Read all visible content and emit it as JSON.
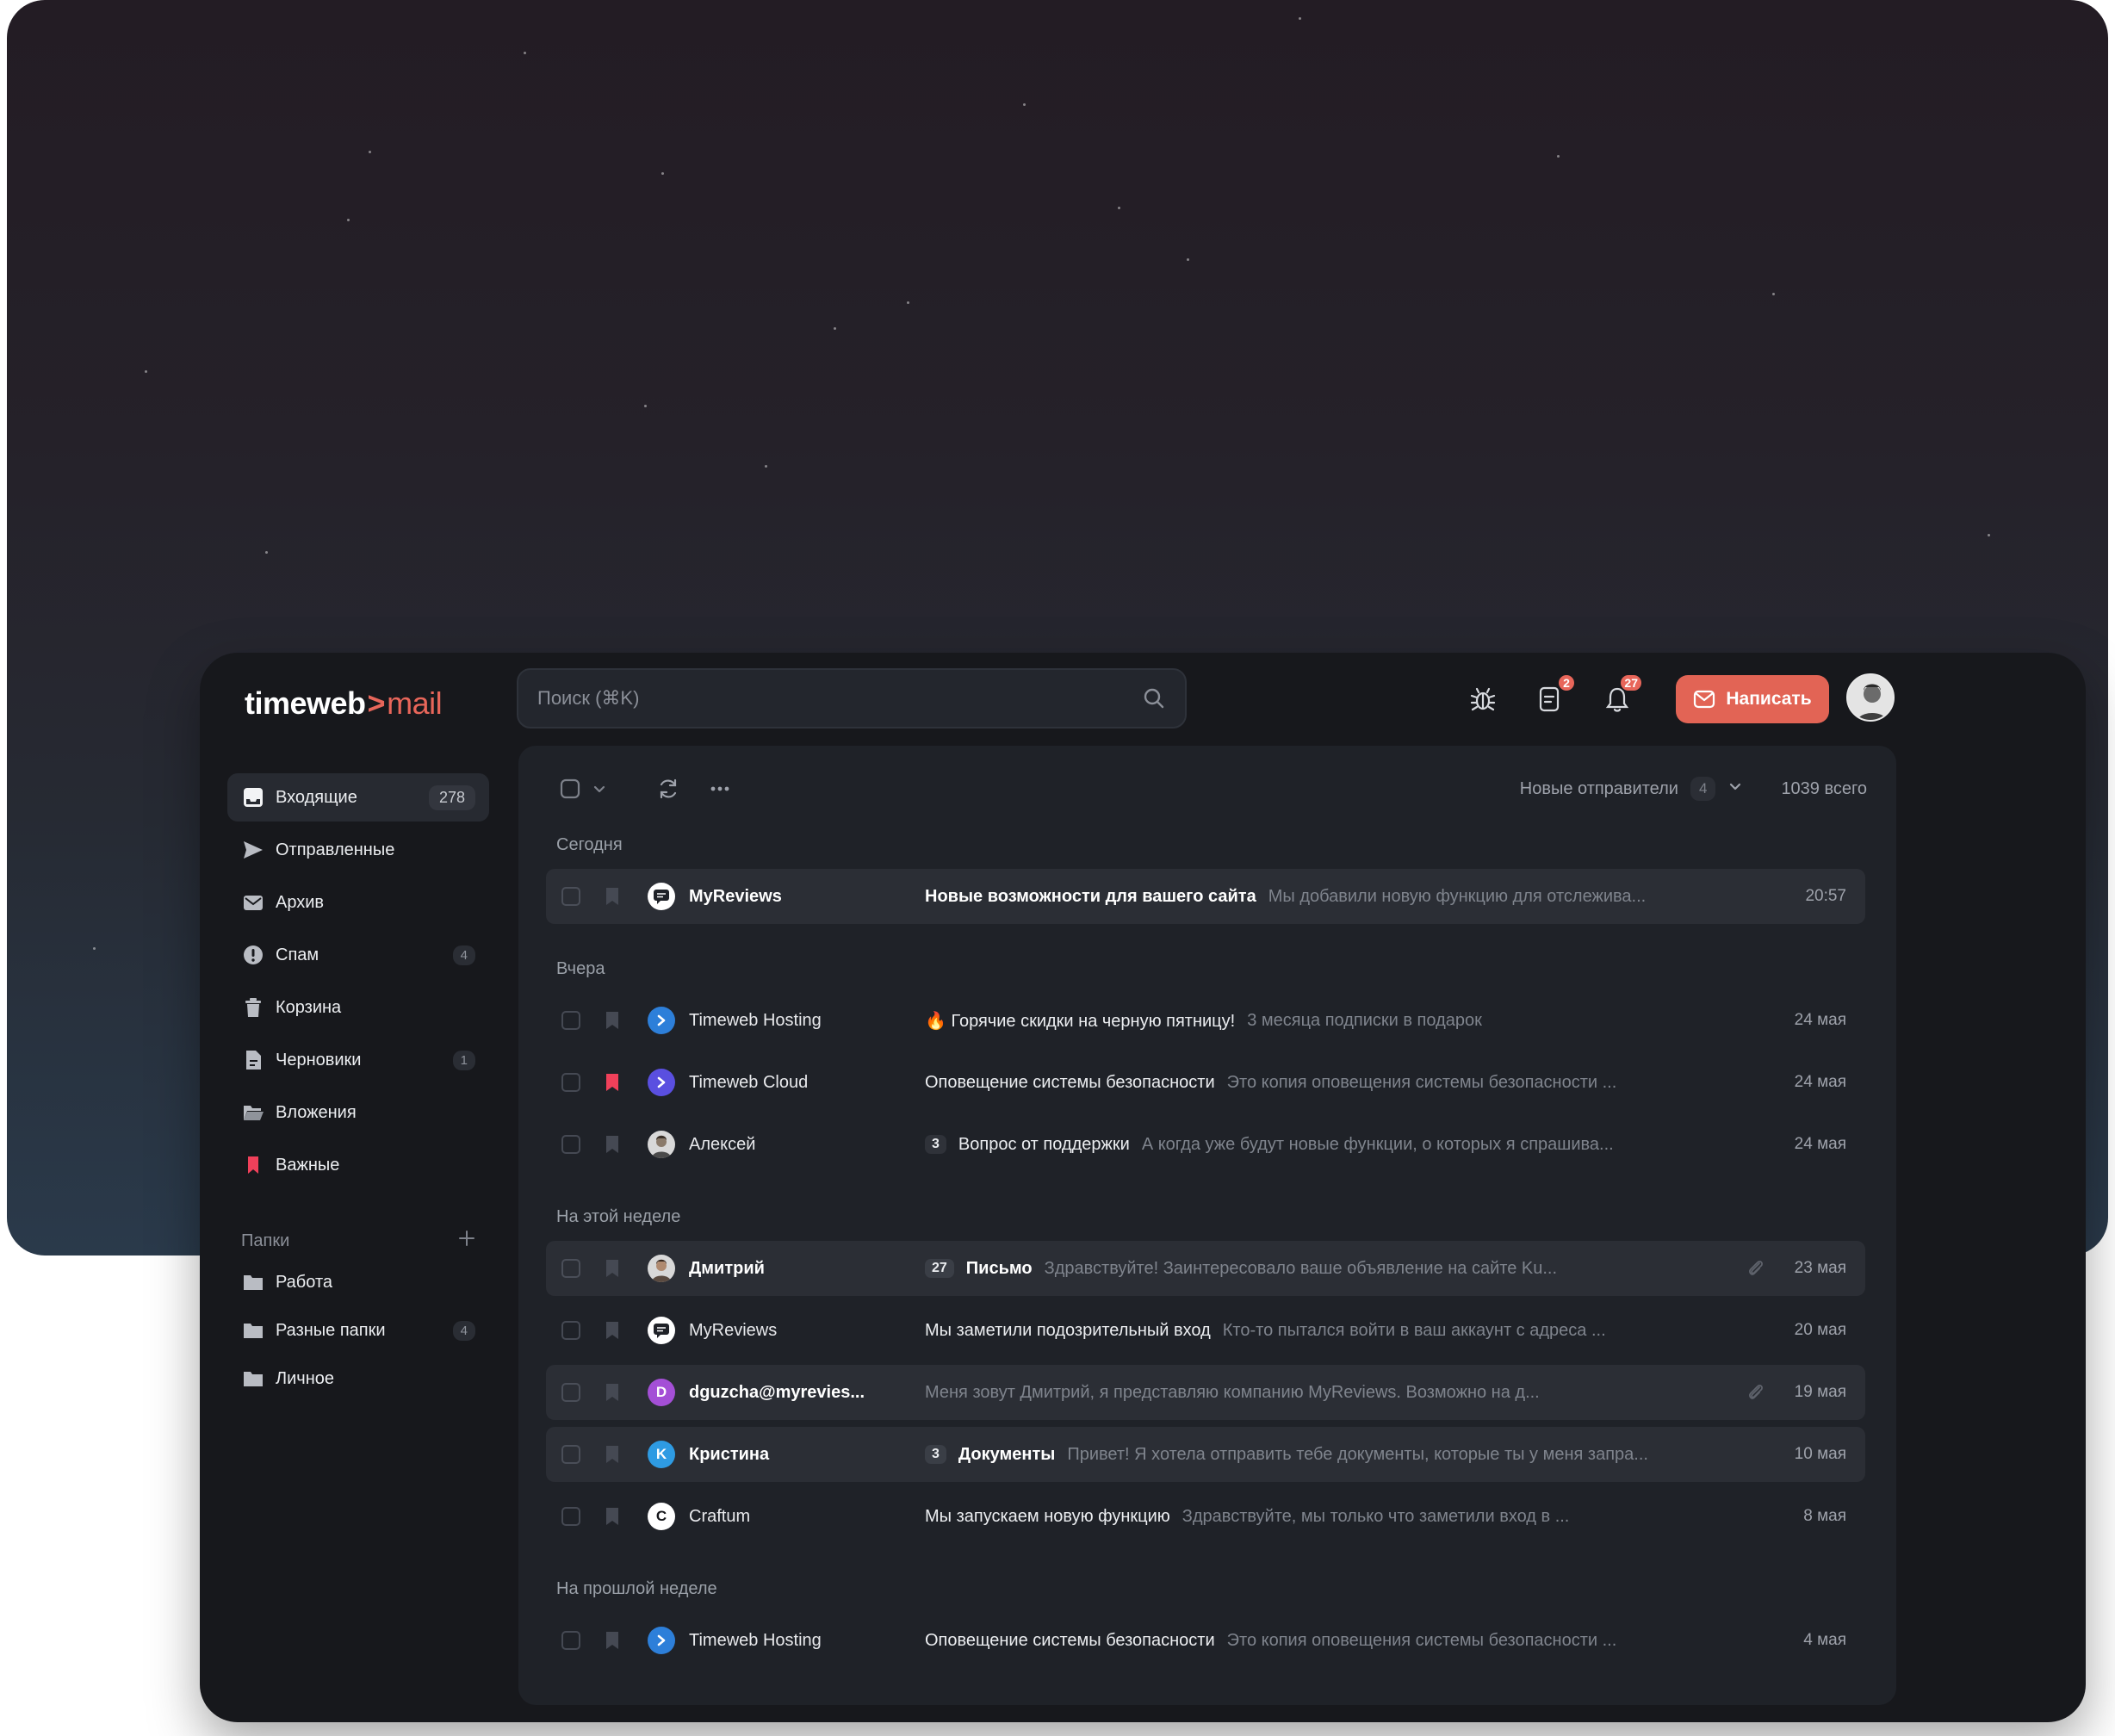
{
  "header": {
    "logo_brand": "timeweb",
    "logo_arrow": ">",
    "logo_product": "mail",
    "search_placeholder": "Поиск (⌘K)",
    "notif_badge_1": "2",
    "notif_badge_2": "27",
    "compose_label": "Написать"
  },
  "sidebar": {
    "items": [
      {
        "label": "Входящие",
        "count": "278"
      },
      {
        "label": "Отправленные",
        "count": ""
      },
      {
        "label": "Архив",
        "count": ""
      },
      {
        "label": "Спам",
        "count": "4"
      },
      {
        "label": "Корзина",
        "count": ""
      },
      {
        "label": "Черновики",
        "count": "1"
      },
      {
        "label": "Вложения",
        "count": ""
      },
      {
        "label": "Важные",
        "count": ""
      }
    ],
    "folders_title": "Папки",
    "folders": [
      {
        "label": "Работа",
        "count": ""
      },
      {
        "label": "Разные папки",
        "count": "4"
      },
      {
        "label": "Личное",
        "count": ""
      }
    ]
  },
  "toolbar": {
    "new_senders_label": "Новые отправители",
    "new_senders_count": "4",
    "total_label": "1039 всего"
  },
  "groups": [
    "Сегодня",
    "Вчера",
    "На этой неделе",
    "На прошлой неделе"
  ],
  "emails": [
    {
      "sender": "MyReviews",
      "count": "",
      "subject": "Новые возможности для вашего сайта",
      "preview": "Мы добавили новую функцию для отслежива...",
      "date": "20:57",
      "avatar": "",
      "unread": true,
      "important": false,
      "attachment": false
    },
    {
      "sender": "Timeweb Hosting",
      "count": "",
      "subject": "🔥 Горячие скидки на черную пятницу!",
      "preview": "3 месяца подписки в подарок",
      "date": "24 мая",
      "avatar": "",
      "unread": false,
      "important": false,
      "attachment": false
    },
    {
      "sender": "Timeweb Cloud",
      "count": "",
      "subject": "Оповещение системы безопасности",
      "preview": "Это копия оповещения системы безопасности ...",
      "date": "24 мая",
      "avatar": "",
      "unread": false,
      "important": true,
      "attachment": false
    },
    {
      "sender": "Алексей",
      "count": "3",
      "subject": "Вопрос от поддержки",
      "preview": "А когда уже будут новые функции, о которых я спрашива...",
      "date": "24 мая",
      "avatar": "",
      "unread": false,
      "important": false,
      "attachment": false
    },
    {
      "sender": "Дмитрий",
      "count": "27",
      "subject": "Письмо",
      "preview": "Здравствуйте! Заинтересовало ваше объявление на сайте Ku...",
      "date": "23 мая",
      "avatar": "",
      "unread": true,
      "important": false,
      "attachment": true
    },
    {
      "sender": "MyReviews",
      "count": "",
      "subject": "Мы заметили подозрительный вход",
      "preview": "Кто-то пытался войти в ваш аккаунт с адреса ...",
      "date": "20 мая",
      "avatar": "",
      "unread": false,
      "important": false,
      "attachment": false
    },
    {
      "sender": "dguzcha@myrevies...",
      "count": "",
      "subject": "",
      "preview": "Меня зовут Дмитрий, я представляю компанию MyReviews. Возможно на д...",
      "date": "19 мая",
      "avatar": "D",
      "unread": true,
      "important": false,
      "attachment": true
    },
    {
      "sender": "Кристина",
      "count": "3",
      "subject": "Документы",
      "preview": "Привет! Я хотела отправить тебе документы, которые ты у меня запра...",
      "date": "10 мая",
      "avatar": "K",
      "unread": true,
      "important": false,
      "attachment": false
    },
    {
      "sender": "Craftum",
      "count": "",
      "subject": "Мы запускаем новую функцию",
      "preview": "Здравствуйте, мы только что заметили вход в ...",
      "date": "8 мая",
      "avatar": "C",
      "unread": false,
      "important": false,
      "attachment": false
    },
    {
      "sender": "Timeweb Hosting",
      "count": "",
      "subject": "Оповещение системы безопасности",
      "preview": "Это копия оповещения системы безопасности ...",
      "date": "4 мая",
      "avatar": "",
      "unread": false,
      "important": false,
      "attachment": false
    }
  ],
  "colors": {
    "accent": "#e26455",
    "important": "#f0405a",
    "timeweb_blue": "#2d7fd9",
    "cloud_violet": "#5a4fe0",
    "avatar_d": "#a44fd6",
    "avatar_k": "#2e9be3"
  }
}
